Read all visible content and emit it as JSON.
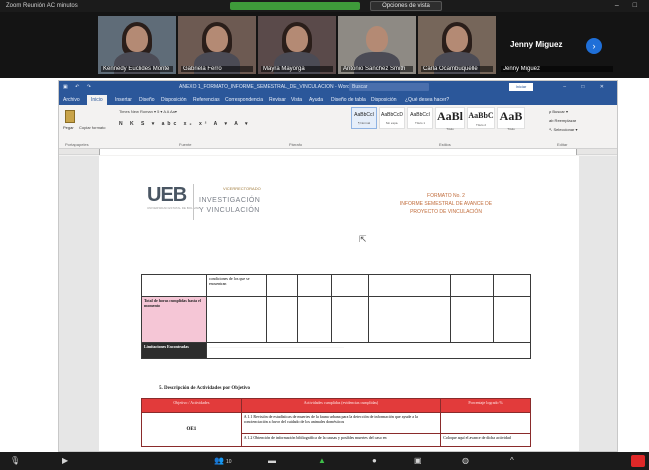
{
  "zoom": {
    "window_title": "Zoom Reunión AC minutos",
    "view_options": "Opciones de vista",
    "window_controls": "–  □",
    "participants": [
      {
        "name": "Kennedy Euclides Monte"
      },
      {
        "name": "Gabriela Ferro"
      },
      {
        "name": "Mayra Mayorga"
      },
      {
        "name": "Antonio Sanchez Smith"
      },
      {
        "name": "Carla Ocambuquelle"
      },
      {
        "name": "Jenny Miguez"
      }
    ],
    "featured_name": "Jenny Miguez",
    "next_arrow": "›",
    "bottom_bar": {
      "mic": "🎙",
      "video": "▶",
      "participants_count": "10",
      "share": "▲",
      "record": "●",
      "chevron": "^"
    }
  },
  "word": {
    "qat": "▣ ↶ ↷",
    "doc_name": "ANEXO 1_FORMATO_INFORME_SEMESTRAL_DE_VINCULACION - Word",
    "search_placeholder": "Buscar",
    "sign_in": "Iniciar",
    "window_controls": "–  □  ✕",
    "tabs": [
      "Archivo",
      "Inicio",
      "Insertar",
      "Diseño",
      "Disposición",
      "Referencias",
      "Correspondencia",
      "Revisar",
      "Vista",
      "Ayuda",
      "Diseño de tabla",
      "Disposición",
      "¿Qué desea hacer?"
    ],
    "active_tab": "Inicio",
    "ribbon": {
      "paste": "Pegar",
      "format_painter": "Copiar formato",
      "font_row": "Times New Roman  ▾  5  ▾  A  A  Aa▾",
      "format_row": "N  K  S  ▾  abc  x₂  x²  A  ▾  A  ▾",
      "styles": [
        {
          "sample": "AaBbCcI",
          "name": "¶ Normal"
        },
        {
          "sample": "AaBbCcD",
          "name": "Sin espa."
        },
        {
          "sample": "AaBbCcI",
          "name": "Título 1"
        },
        {
          "sample": "AaBl",
          "name": "Título"
        },
        {
          "sample": "AaBbC",
          "name": "Título 2"
        },
        {
          "sample": "AaB",
          "name": "Título"
        }
      ],
      "edit": [
        "ρ Buscar ▾",
        "ab Reemplazar",
        "↖ Seleccionar ▾"
      ],
      "group_labels": [
        "Portapapeles",
        "Fuente",
        "Párrafo",
        "Estilos",
        "Editar"
      ]
    }
  },
  "document": {
    "logo": "UEB",
    "logo_sub": "UNIVERSIDAD ESTATAL DE BOLÍVAR",
    "logo_top": "VICERRECTORADO",
    "unit_line1": "INVESTIGACIÓN",
    "unit_line2": "Y VINCULACIÓN",
    "header_right": [
      "FORMATO No. 2",
      "INFORME SEMESTRAL DE AVANCE DE",
      "PROYECTO DE VINCULACIÓN"
    ],
    "table1": {
      "row0_text": "condiciones de los que se encuentran",
      "row1_label": "Total de horas cumplidas hasta el momento",
      "row2_label": "Limitaciones Encontradas",
      "row2_text": "......................................................................................................................................."
    },
    "section_title": "5.   Descripción de Actividades por Objetivo",
    "table2": {
      "headers": [
        "Objetivo / Actividades",
        "Actividades cumplidas (evidencias cumplidas)",
        "Porcentaje logrado %"
      ],
      "objective": "OE1",
      "act1": "A 1.1 Revisión de estadísticas de muertes de la fauna urbana para la detección de información que ayude a la concienciación a favor del cuidado de los animales domésticos",
      "act2": "A 1.2 Obtención de información bibliográfica de la causas y posibles muertes del caso en",
      "pct": "Coloque aquí el avance de dicha actividad"
    }
  }
}
